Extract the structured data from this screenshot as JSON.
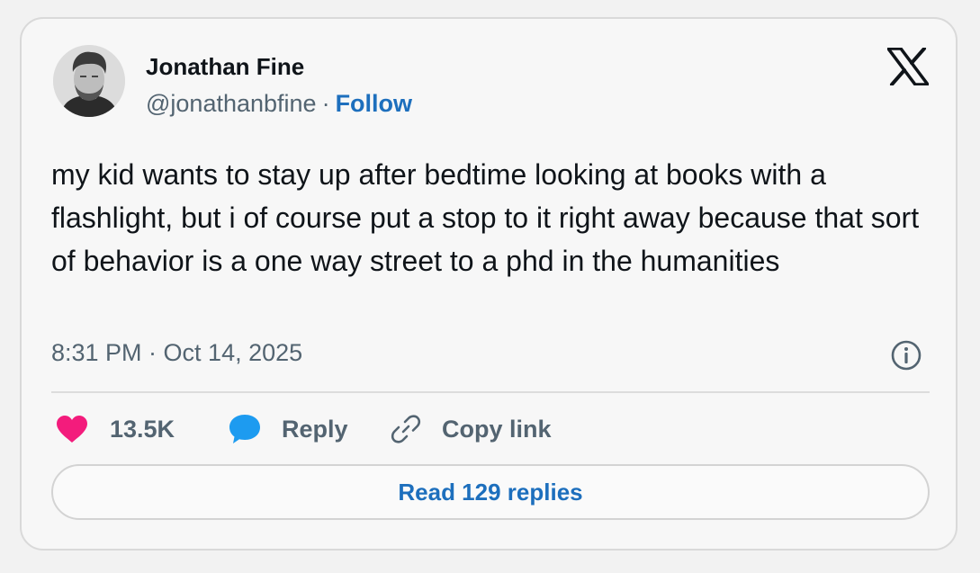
{
  "author": {
    "name": "Jonathan Fine",
    "handle": "@jonathanbfine",
    "separator": "·",
    "follow_label": "Follow"
  },
  "tweet": {
    "text": "my kid wants to stay up after bedtime looking at books with a flashlight, but i of course put a stop to it right away because that sort of behavior is a one way street to a phd in the humanities",
    "timestamp": "8:31 PM · Oct 14, 2025"
  },
  "actions": {
    "like_count": "13.5K",
    "reply_label": "Reply",
    "copy_link_label": "Copy link"
  },
  "read_replies_label": "Read 129 replies",
  "icons": {
    "brand": "x-logo-icon",
    "info": "info-icon",
    "like": "heart-icon",
    "reply": "speech-bubble-icon",
    "copy": "link-icon"
  },
  "colors": {
    "like": "#f31c7c",
    "reply": "#1d9bf0",
    "link": "#1d6fbd",
    "muted": "#536471",
    "text": "#0f1419"
  }
}
